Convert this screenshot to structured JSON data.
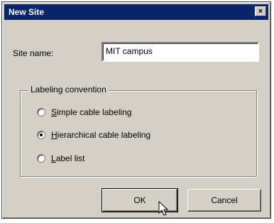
{
  "window": {
    "title": "New Site",
    "close_glyph": "×"
  },
  "site_name": {
    "label": "Site name:",
    "value": "MIT campus"
  },
  "labeling": {
    "group_label": "Labeling convention",
    "options": [
      {
        "mn": "S",
        "rest": "imple cable labeling",
        "checked": false
      },
      {
        "mn": "H",
        "rest": "ierarchical cable labeling",
        "checked": true
      },
      {
        "mn": "L",
        "rest": "abel list",
        "checked": false
      }
    ]
  },
  "buttons": {
    "ok": "OK",
    "cancel": "Cancel"
  },
  "icons": {
    "close": "close-icon",
    "cursor": "mouse-pointer-icon"
  }
}
